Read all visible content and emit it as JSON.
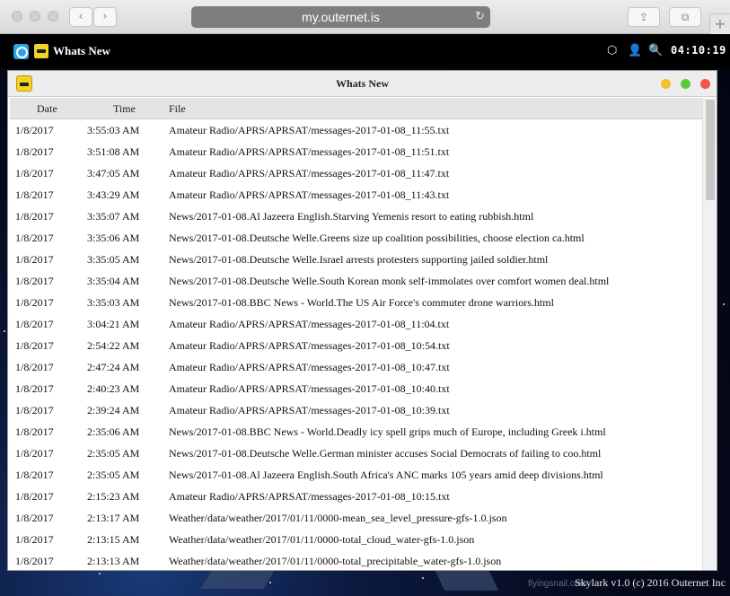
{
  "browser": {
    "url": "my.outernet.is",
    "back_glyph": "‹",
    "forward_glyph": "›",
    "reload_glyph": "↻",
    "share_glyph": "⇪",
    "tabs_glyph": "⧉",
    "newtab_glyph": "+"
  },
  "topbar": {
    "app_label": "Whats New",
    "clock": "04:10:19",
    "tray": {
      "network_glyph": "⬡",
      "user_glyph": "👤",
      "search_glyph": "🔍"
    }
  },
  "window": {
    "title": "Whats New",
    "controls": {
      "minimize_color": "#f4bf2c",
      "maximize_color": "#5fc93d",
      "close_color": "#f2554c"
    },
    "columns": {
      "date": "Date",
      "time": "Time",
      "file": "File"
    },
    "rows": [
      {
        "date": "1/8/2017",
        "time": "3:55:03 AM",
        "file": "Amateur Radio/APRS/APRSAT/messages-2017-01-08_11:55.txt"
      },
      {
        "date": "1/8/2017",
        "time": "3:51:08 AM",
        "file": "Amateur Radio/APRS/APRSAT/messages-2017-01-08_11:51.txt"
      },
      {
        "date": "1/8/2017",
        "time": "3:47:05 AM",
        "file": "Amateur Radio/APRS/APRSAT/messages-2017-01-08_11:47.txt"
      },
      {
        "date": "1/8/2017",
        "time": "3:43:29 AM",
        "file": "Amateur Radio/APRS/APRSAT/messages-2017-01-08_11:43.txt"
      },
      {
        "date": "1/8/2017",
        "time": "3:35:07 AM",
        "file": "News/2017-01-08.Al Jazeera English.Starving Yemenis resort to eating rubbish.html"
      },
      {
        "date": "1/8/2017",
        "time": "3:35:06 AM",
        "file": "News/2017-01-08.Deutsche Welle.Greens size up coalition possibilities, choose election ca.html"
      },
      {
        "date": "1/8/2017",
        "time": "3:35:05 AM",
        "file": "News/2017-01-08.Deutsche Welle.Israel arrests protesters supporting jailed soldier.html"
      },
      {
        "date": "1/8/2017",
        "time": "3:35:04 AM",
        "file": "News/2017-01-08.Deutsche Welle.South Korean monk self-immolates over comfort women deal.html"
      },
      {
        "date": "1/8/2017",
        "time": "3:35:03 AM",
        "file": "News/2017-01-08.BBC News - World.The US Air Force's commuter drone warriors.html"
      },
      {
        "date": "1/8/2017",
        "time": "3:04:21 AM",
        "file": "Amateur Radio/APRS/APRSAT/messages-2017-01-08_11:04.txt"
      },
      {
        "date": "1/8/2017",
        "time": "2:54:22 AM",
        "file": "Amateur Radio/APRS/APRSAT/messages-2017-01-08_10:54.txt"
      },
      {
        "date": "1/8/2017",
        "time": "2:47:24 AM",
        "file": "Amateur Radio/APRS/APRSAT/messages-2017-01-08_10:47.txt"
      },
      {
        "date": "1/8/2017",
        "time": "2:40:23 AM",
        "file": "Amateur Radio/APRS/APRSAT/messages-2017-01-08_10:40.txt"
      },
      {
        "date": "1/8/2017",
        "time": "2:39:24 AM",
        "file": "Amateur Radio/APRS/APRSAT/messages-2017-01-08_10:39.txt"
      },
      {
        "date": "1/8/2017",
        "time": "2:35:06 AM",
        "file": "News/2017-01-08.BBC News - World.Deadly icy spell grips much of Europe, including Greek i.html"
      },
      {
        "date": "1/8/2017",
        "time": "2:35:05 AM",
        "file": "News/2017-01-08.Deutsche Welle.German minister accuses Social Democrats of failing to coo.html"
      },
      {
        "date": "1/8/2017",
        "time": "2:35:05 AM",
        "file": "News/2017-01-08.Al Jazeera English.South Africa's ANC marks 105 years amid deep divisions.html"
      },
      {
        "date": "1/8/2017",
        "time": "2:15:23 AM",
        "file": "Amateur Radio/APRS/APRSAT/messages-2017-01-08_10:15.txt"
      },
      {
        "date": "1/8/2017",
        "time": "2:13:17 AM",
        "file": "Weather/data/weather/2017/01/11/0000-mean_sea_level_pressure-gfs-1.0.json"
      },
      {
        "date": "1/8/2017",
        "time": "2:13:15 AM",
        "file": "Weather/data/weather/2017/01/11/0000-total_cloud_water-gfs-1.0.json"
      },
      {
        "date": "1/8/2017",
        "time": "2:13:13 AM",
        "file": "Weather/data/weather/2017/01/11/0000-total_precipitable_water-gfs-1.0.json"
      }
    ]
  },
  "footer": {
    "watermark": "flyingsnail.com",
    "copyright": "Skylark v1.0 (c) 2016 Outernet Inc"
  }
}
